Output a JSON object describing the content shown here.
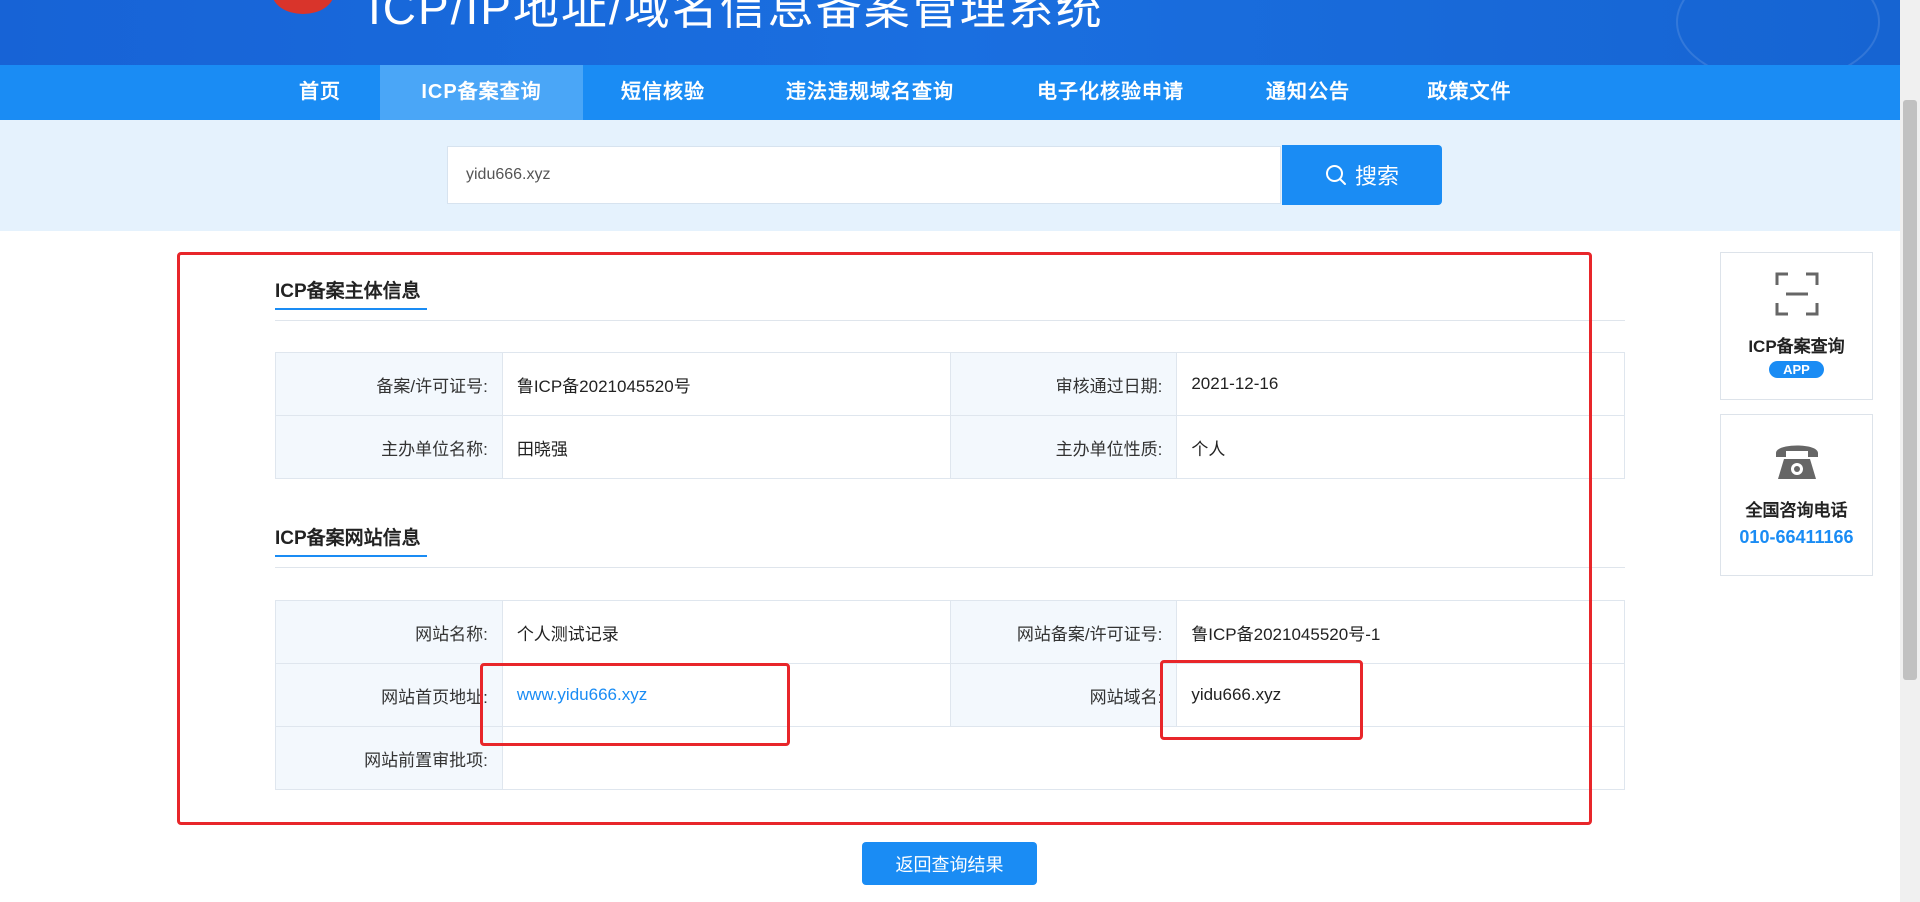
{
  "header": {
    "title": "ICP/IP地址/域名信息备案管理系统"
  },
  "nav": {
    "items": [
      {
        "label": "首页",
        "active": false
      },
      {
        "label": "ICP备案查询",
        "active": true
      },
      {
        "label": "短信核验",
        "active": false
      },
      {
        "label": "违法违规域名查询",
        "active": false
      },
      {
        "label": "电子化核验申请",
        "active": false
      },
      {
        "label": "通知公告",
        "active": false
      },
      {
        "label": "政策文件",
        "active": false
      }
    ]
  },
  "search": {
    "value": "yidu666.xyz",
    "button_label": "搜索"
  },
  "subject_info": {
    "title": "ICP备案主体信息",
    "license_label": "备案/许可证号:",
    "license_value": "鲁ICP备2021045520号",
    "approval_date_label": "审核通过日期:",
    "approval_date_value": "2021-12-16",
    "org_name_label": "主办单位名称:",
    "org_name_value": "田晓强",
    "org_type_label": "主办单位性质:",
    "org_type_value": "个人"
  },
  "website_info": {
    "title": "ICP备案网站信息",
    "site_name_label": "网站名称:",
    "site_name_value": "个人测试记录",
    "site_license_label": "网站备案/许可证号:",
    "site_license_value": "鲁ICP备2021045520号-1",
    "homepage_label": "网站首页地址:",
    "homepage_value": "www.yidu666.xyz",
    "domain_label": "网站域名:",
    "domain_value": "yidu666.xyz",
    "preapproval_label": "网站前置审批项:",
    "preapproval_value": ""
  },
  "return_button_label": "返回查询结果",
  "side": {
    "app_title": "ICP备案查询",
    "app_badge": "APP",
    "phone_title": "全国咨询电话",
    "phone_number": "010-66411166"
  },
  "colors": {
    "primary": "#1a8cf4",
    "banner": "#1763d6",
    "annotation_red": "#e8262a"
  }
}
